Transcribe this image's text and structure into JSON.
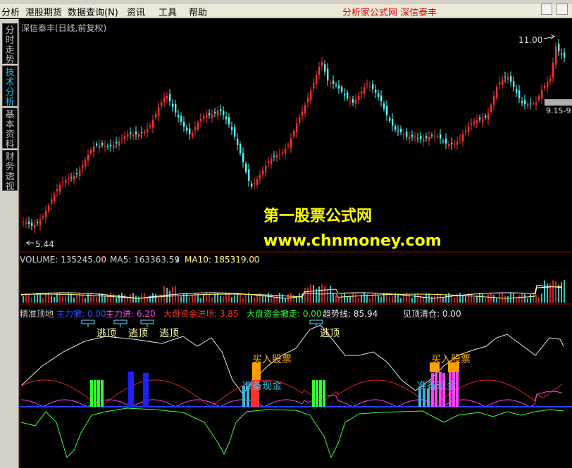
{
  "menu": {
    "items": [
      "分析",
      "港股期货",
      "数据查询(N)",
      "资讯",
      "工具",
      "帮助"
    ],
    "title": "分析家公式网  深信泰丰"
  },
  "sidebar": {
    "tabs": [
      {
        "label": "分时走势",
        "active": false
      },
      {
        "label": "技术分析",
        "active": true
      },
      {
        "label": "基本资料",
        "active": false
      },
      {
        "label": "财务透视",
        "active": false
      }
    ]
  },
  "price_panel": {
    "title": "深信泰丰(日线,前复权)",
    "high_label": "11.00",
    "low_label": "5.44",
    "range_label": "9.15-9.",
    "watermark_cn": "第一股票公式网",
    "watermark_url": "www.chnmoney.com",
    "up_color": "#ff3030",
    "down_color": "#54fcfc"
  },
  "volume_panel": {
    "volume_label": "VOLUME: 135245.00",
    "ma5_label": "MA5: 163363.59",
    "ma10_label": "MA10: 185319.00"
  },
  "indicator_panel": {
    "name": "精准顶地",
    "main_out": "主力撤: 0.00",
    "main_in": "主力进: 6.20",
    "big_in": "大盘资金进场: 3.85",
    "big_out": "大盘资金撤走: 0.00",
    "trend": "趋势线: 85.94",
    "clear": "见顶清仓: 0.00",
    "escape_labels": [
      "逃顶",
      "逃顶",
      "逃顶",
      "逃顶"
    ],
    "buy_labels": [
      "买入股票",
      "买入股票"
    ],
    "cash_labels": [
      "准备现金",
      "准备现金"
    ]
  }
}
